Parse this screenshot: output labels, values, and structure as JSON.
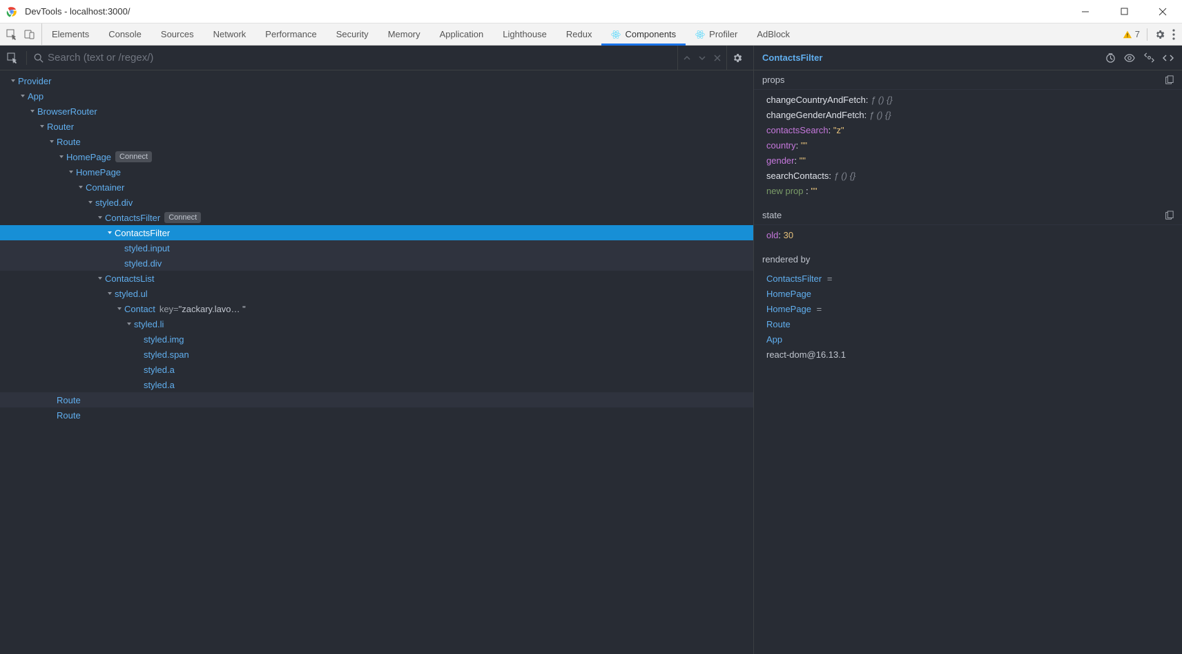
{
  "window": {
    "title": "DevTools - localhost:3000/"
  },
  "tabs": {
    "items": [
      "Elements",
      "Console",
      "Sources",
      "Network",
      "Performance",
      "Security",
      "Memory",
      "Application",
      "Lighthouse",
      "Redux",
      "Components",
      "Profiler",
      "AdBlock"
    ],
    "active": "Components",
    "reactTabs": [
      "Components",
      "Profiler"
    ]
  },
  "warnings": {
    "count": "7"
  },
  "search": {
    "placeholder": "Search (text or /regex/)"
  },
  "tree": [
    {
      "depth": 0,
      "caret": true,
      "name": "Provider"
    },
    {
      "depth": 1,
      "caret": true,
      "name": "App"
    },
    {
      "depth": 2,
      "caret": true,
      "name": "BrowserRouter"
    },
    {
      "depth": 3,
      "caret": true,
      "name": "Router"
    },
    {
      "depth": 4,
      "caret": true,
      "name": "Route"
    },
    {
      "depth": 5,
      "caret": true,
      "name": "HomePage",
      "badge": "Connect"
    },
    {
      "depth": 6,
      "caret": true,
      "name": "HomePage"
    },
    {
      "depth": 7,
      "caret": true,
      "name": "Container"
    },
    {
      "depth": 8,
      "caret": true,
      "name": "styled.div"
    },
    {
      "depth": 9,
      "caret": true,
      "name": "ContactsFilter",
      "badge": "Connect"
    },
    {
      "depth": 10,
      "caret": true,
      "name": "ContactsFilter",
      "selected": true
    },
    {
      "depth": 11,
      "name": "styled.input",
      "dim": true
    },
    {
      "depth": 11,
      "name": "styled.div",
      "dim": true
    },
    {
      "depth": 9,
      "caret": true,
      "name": "ContactsList"
    },
    {
      "depth": 10,
      "caret": true,
      "name": "styled.ul"
    },
    {
      "depth": 11,
      "caret": true,
      "name": "Contact",
      "key": "\"zackary.lavo… \""
    },
    {
      "depth": 12,
      "caret": true,
      "name": "styled.li"
    },
    {
      "depth": 13,
      "name": "styled.img"
    },
    {
      "depth": 13,
      "name": "styled.span"
    },
    {
      "depth": 13,
      "name": "styled.a"
    },
    {
      "depth": 13,
      "name": "styled.a"
    },
    {
      "depth": 4,
      "name": "Route",
      "dim": true
    },
    {
      "depth": 4,
      "name": "Route"
    }
  ],
  "detail": {
    "componentName": "ContactsFilter",
    "props": {
      "label": "props",
      "items": [
        {
          "key": "changeCountryAndFetch",
          "ktype": "plain",
          "vtype": "fn"
        },
        {
          "key": "changeGenderAndFetch",
          "ktype": "plain",
          "vtype": "fn"
        },
        {
          "key": "contactsSearch",
          "ktype": "purple",
          "vtype": "str",
          "val": "\"z\""
        },
        {
          "key": "country",
          "ktype": "purple",
          "vtype": "str",
          "val": "\"\""
        },
        {
          "key": "gender",
          "ktype": "purple",
          "vtype": "str",
          "val": "\"\""
        },
        {
          "key": "searchContacts",
          "ktype": "plain",
          "vtype": "fn"
        },
        {
          "key": "new prop   ",
          "ktype": "hover",
          "vtype": "str",
          "val": "\"\""
        }
      ]
    },
    "state": {
      "label": "state",
      "items": [
        {
          "key": "old",
          "ktype": "purple",
          "vtype": "num",
          "val": "30"
        }
      ]
    },
    "renderedBy": {
      "label": "rendered by",
      "items": [
        {
          "text": "ContactsFilter",
          "suffix": " ="
        },
        {
          "text": "HomePage"
        },
        {
          "text": "HomePage",
          "suffix": " ="
        },
        {
          "text": "Route"
        },
        {
          "text": "App"
        },
        {
          "text": "react-dom@16.13.1",
          "plain": true
        }
      ]
    }
  },
  "colors": {
    "accent": "#1a73e8",
    "link": "#61afef",
    "string": "#e5c07b",
    "purple": "#c678dd"
  }
}
